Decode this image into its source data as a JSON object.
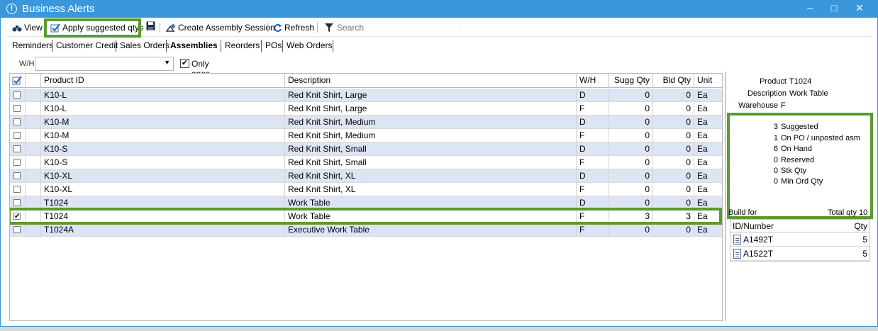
{
  "window": {
    "title": "Business Alerts"
  },
  "toolbar": {
    "view_label": "View",
    "apply_label": "Apply suggested qtys",
    "create_assembly_label": "Create Assembly Session",
    "refresh_label": "Refresh",
    "search_placeholder": "Search"
  },
  "tabs": [
    {
      "label": "Reminders"
    },
    {
      "label": "Customer Credit"
    },
    {
      "label": "Sales Orders"
    },
    {
      "label": "Assemblies",
      "active": true
    },
    {
      "label": "Reorders"
    },
    {
      "label": "POs"
    },
    {
      "label": "Web Orders"
    }
  ],
  "filter": {
    "wh_label": "W/H",
    "wh_value": "",
    "only_sales_orders_label": "Only ones on sales orders",
    "only_sales_orders_checked": true
  },
  "grid": {
    "columns": [
      "Product ID",
      "Description",
      "W/H",
      "Sugg Qty",
      "Bld Qty",
      "Unit"
    ],
    "rows": [
      {
        "checked": false,
        "product_id": "K10-L",
        "description": "Red Knit Shirt, Large",
        "wh": "D",
        "sugg_qty": "0",
        "bld_qty": "0",
        "unit": "Ea"
      },
      {
        "checked": false,
        "product_id": "K10-L",
        "description": "Red Knit Shirt, Large",
        "wh": "F",
        "sugg_qty": "0",
        "bld_qty": "0",
        "unit": "Ea"
      },
      {
        "checked": false,
        "product_id": "K10-M",
        "description": "Red Knit Shirt, Medium",
        "wh": "D",
        "sugg_qty": "0",
        "bld_qty": "0",
        "unit": "Ea"
      },
      {
        "checked": false,
        "product_id": "K10-M",
        "description": "Red Knit Shirt, Medium",
        "wh": "F",
        "sugg_qty": "0",
        "bld_qty": "0",
        "unit": "Ea"
      },
      {
        "checked": false,
        "product_id": "K10-S",
        "description": "Red Knit Shirt, Small",
        "wh": "D",
        "sugg_qty": "0",
        "bld_qty": "0",
        "unit": "Ea"
      },
      {
        "checked": false,
        "product_id": "K10-S",
        "description": "Red Knit Shirt, Small",
        "wh": "F",
        "sugg_qty": "0",
        "bld_qty": "0",
        "unit": "Ea"
      },
      {
        "checked": false,
        "product_id": "K10-XL",
        "description": "Red Knit Shirt, XL",
        "wh": "D",
        "sugg_qty": "0",
        "bld_qty": "0",
        "unit": "Ea"
      },
      {
        "checked": false,
        "product_id": "K10-XL",
        "description": "Red Knit Shirt, XL",
        "wh": "F",
        "sugg_qty": "0",
        "bld_qty": "0",
        "unit": "Ea"
      },
      {
        "checked": false,
        "product_id": "T1024",
        "description": "Work Table",
        "wh": "D",
        "sugg_qty": "0",
        "bld_qty": "0",
        "unit": "Ea"
      },
      {
        "checked": true,
        "product_id": "T1024",
        "description": "Work Table",
        "wh": "F",
        "sugg_qty": "3",
        "bld_qty": "3",
        "unit": "Ea",
        "selected": true
      },
      {
        "checked": false,
        "product_id": "T1024A",
        "description": "Executive Work Table",
        "wh": "F",
        "sugg_qty": "0",
        "bld_qty": "0",
        "unit": "Ea"
      }
    ]
  },
  "details": {
    "product_label": "Product",
    "product_value": "T1024",
    "description_label": "Description",
    "description_value": "Work Table",
    "warehouse_label": "Warehouse",
    "warehouse_value": "F",
    "stats": [
      {
        "n": "3",
        "t": "Suggested"
      },
      {
        "n": "1",
        "t": "On PO / unposted asm"
      },
      {
        "n": "6",
        "t": "On Hand"
      },
      {
        "n": "0",
        "t": "Reserved"
      },
      {
        "n": "0",
        "t": "Stk Qty"
      },
      {
        "n": "0",
        "t": "Min Ord Qty"
      }
    ],
    "build_for_label": "Build for",
    "total_qty_label": "Total qty 10",
    "orders_columns": [
      "ID/Number",
      "Qty"
    ],
    "orders": [
      {
        "id": "A1492T",
        "qty": "5"
      },
      {
        "id": "A1522T",
        "qty": "5"
      }
    ]
  },
  "colors": {
    "title_bar": "#3b97db",
    "highlight": "#5a9a32",
    "alt_row": "#dde4f4"
  }
}
